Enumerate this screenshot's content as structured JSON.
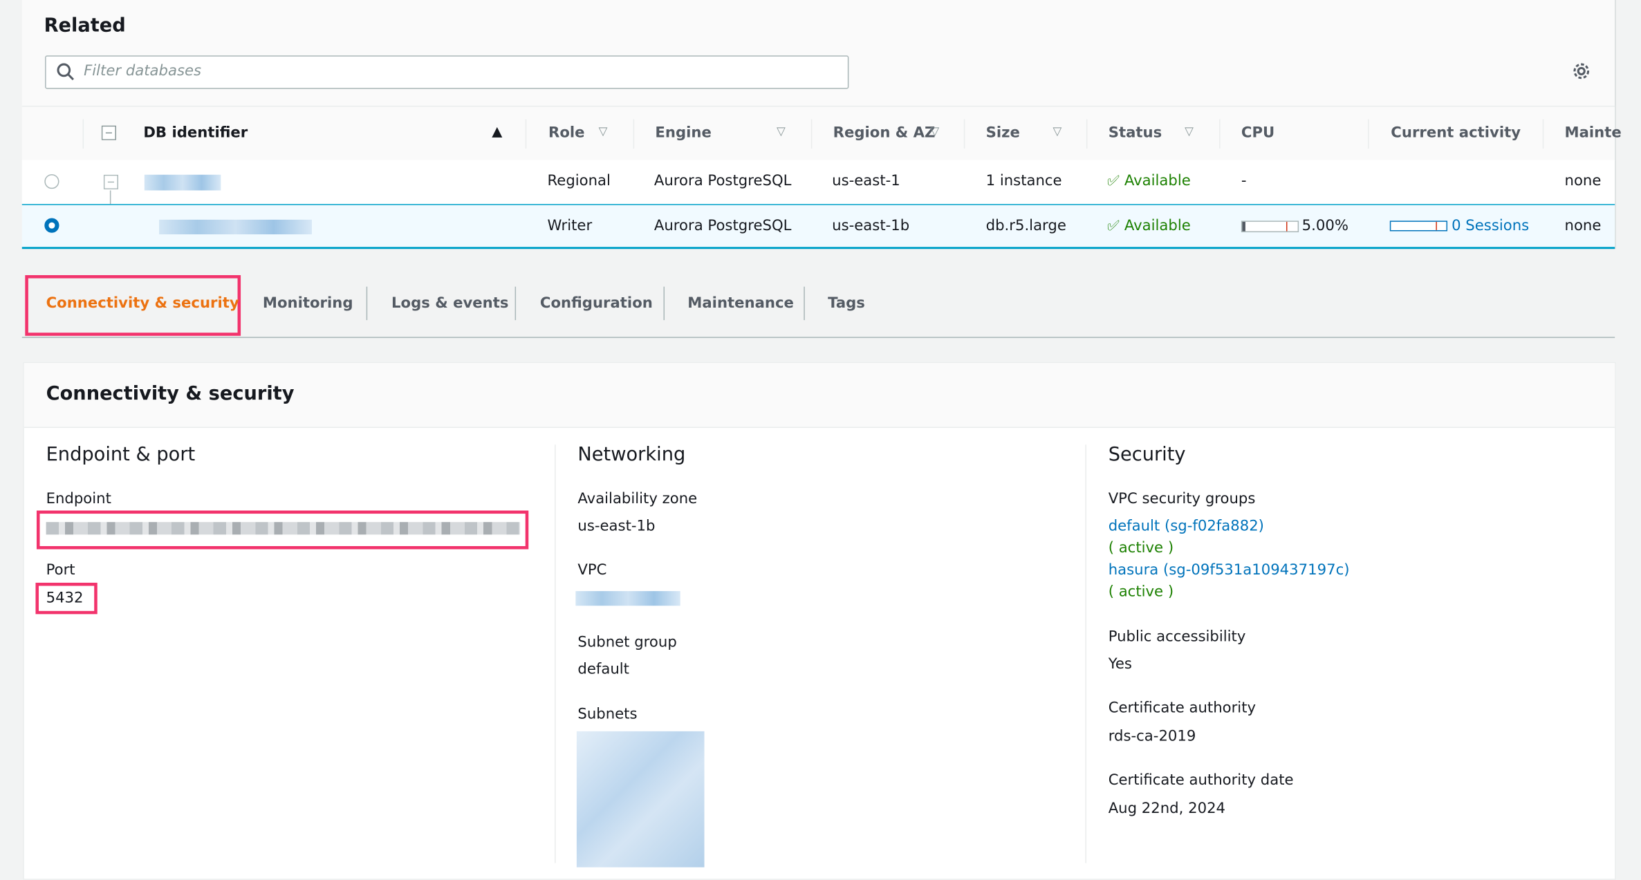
{
  "related": {
    "title": "Related",
    "search_placeholder": "Filter databases",
    "settings_icon": "gear-icon"
  },
  "table": {
    "columns": [
      "DB identifier",
      "Role",
      "Engine",
      "Region & AZ",
      "Size",
      "Status",
      "CPU",
      "Current activity",
      "Mainte"
    ],
    "rows": [
      {
        "role": "Regional",
        "engine": "Aurora PostgreSQL",
        "region": "us-east-1",
        "size": "1 instance",
        "status": "Available",
        "cpu": "-",
        "activity": "",
        "maintenance": "none",
        "selected": false
      },
      {
        "role": "Writer",
        "engine": "Aurora PostgreSQL",
        "region": "us-east-1b",
        "size": "db.r5.large",
        "status": "Available",
        "cpu": "5.00%",
        "cpu_percent": 5,
        "activity": "0 Sessions",
        "maintenance": "none",
        "selected": true
      }
    ]
  },
  "tabs": [
    "Connectivity & security",
    "Monitoring",
    "Logs & events",
    "Configuration",
    "Maintenance",
    "Tags"
  ],
  "active_tab": "Connectivity & security",
  "section": {
    "title": "Connectivity & security",
    "endpoint_port": {
      "heading": "Endpoint & port",
      "endpoint_label": "Endpoint",
      "port_label": "Port",
      "port": "5432"
    },
    "networking": {
      "heading": "Networking",
      "az_label": "Availability zone",
      "az": "us-east-1b",
      "vpc_label": "VPC",
      "subnet_group_label": "Subnet group",
      "subnet_group": "default",
      "subnets_label": "Subnets"
    },
    "security": {
      "heading": "Security",
      "vpc_sg_label": "VPC security groups",
      "sg1": "default (sg-f02fa882)",
      "sg1_status": "( active )",
      "sg2": "hasura (sg-09f531a109437197c)",
      "sg2_status": "( active )",
      "public_label": "Public accessibility",
      "public": "Yes",
      "ca_label": "Certificate authority",
      "ca": "rds-ca-2019",
      "ca_date_label": "Certificate authority date",
      "ca_date": "Aug 22nd, 2024"
    }
  },
  "colors": {
    "accent": "#ec7211",
    "link": "#0073bb",
    "available": "#1d8102",
    "highlight": "#f2336c",
    "selected_row": "#f1faff"
  }
}
